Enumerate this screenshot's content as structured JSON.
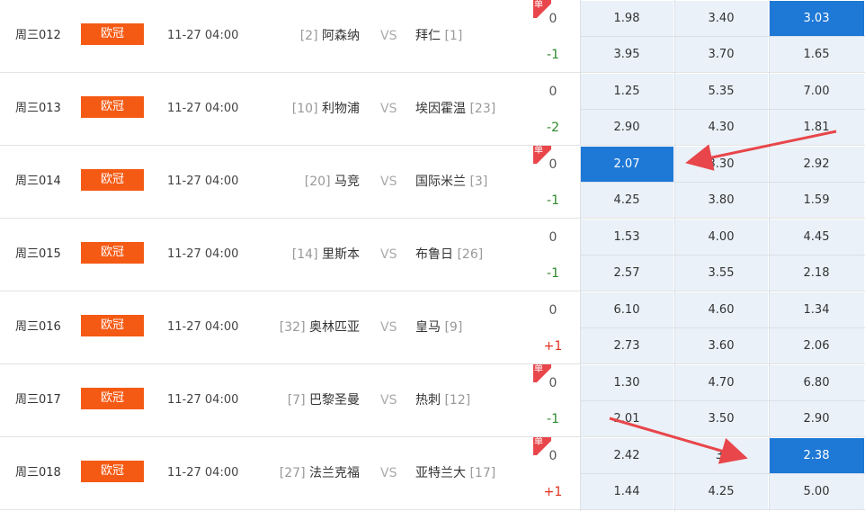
{
  "matches": [
    {
      "num": "周三012",
      "league": "欧冠",
      "time": "11-27 04:00",
      "home_rank": "[2]",
      "home": "阿森纳",
      "vs": "VS",
      "away": "拜仁",
      "away_rank": "[1]",
      "single": true,
      "hc1": "0",
      "hc2": "-1",
      "odds1": [
        "1.98",
        "3.40",
        "3.03"
      ],
      "odds2": [
        "3.95",
        "3.70",
        "1.65"
      ],
      "sel": [
        0,
        2
      ]
    },
    {
      "num": "周三013",
      "league": "欧冠",
      "time": "11-27 04:00",
      "home_rank": "[10]",
      "home": "利物浦",
      "vs": "VS",
      "away": "埃因霍温",
      "away_rank": "[23]",
      "single": false,
      "hc1": "0",
      "hc2": "-2",
      "odds1": [
        "1.25",
        "5.35",
        "7.00"
      ],
      "odds2": [
        "2.90",
        "4.30",
        "1.81"
      ],
      "sel": null
    },
    {
      "num": "周三014",
      "league": "欧冠",
      "time": "11-27 04:00",
      "home_rank": "[20]",
      "home": "马竞",
      "vs": "VS",
      "away": "国际米兰",
      "away_rank": "[3]",
      "single": true,
      "hc1": "0",
      "hc2": "-1",
      "odds1": [
        "2.07",
        "3.30",
        "2.92"
      ],
      "odds2": [
        "4.25",
        "3.80",
        "1.59"
      ],
      "sel": [
        0,
        0
      ]
    },
    {
      "num": "周三015",
      "league": "欧冠",
      "time": "11-27 04:00",
      "home_rank": "[14]",
      "home": "里斯本",
      "vs": "VS",
      "away": "布鲁日",
      "away_rank": "[26]",
      "single": false,
      "hc1": "0",
      "hc2": "-1",
      "odds1": [
        "1.53",
        "4.00",
        "4.45"
      ],
      "odds2": [
        "2.57",
        "3.55",
        "2.18"
      ],
      "sel": null
    },
    {
      "num": "周三016",
      "league": "欧冠",
      "time": "11-27 04:00",
      "home_rank": "[32]",
      "home": "奥林匹亚",
      "vs": "VS",
      "away": "皇马",
      "away_rank": "[9]",
      "single": false,
      "hc1": "0",
      "hc2": "+1",
      "odds1": [
        "6.10",
        "4.60",
        "1.34"
      ],
      "odds2": [
        "2.73",
        "3.60",
        "2.06"
      ],
      "sel": null
    },
    {
      "num": "周三017",
      "league": "欧冠",
      "time": "11-27 04:00",
      "home_rank": "[7]",
      "home": "巴黎圣曼",
      "vs": "VS",
      "away": "热刺",
      "away_rank": "[12]",
      "single": true,
      "hc1": "0",
      "hc2": "-1",
      "odds1": [
        "1.30",
        "4.70",
        "6.80"
      ],
      "odds2": [
        "2.01",
        "3.50",
        "2.90"
      ],
      "sel": null
    },
    {
      "num": "周三018",
      "league": "欧冠",
      "time": "11-27 04:00",
      "home_rank": "[27]",
      "home": "法兰克福",
      "vs": "VS",
      "away": "亚特兰大",
      "away_rank": "[17]",
      "single": true,
      "hc1": "0",
      "hc2": "+1",
      "odds1": [
        "2.42",
        "3.",
        "2.38"
      ],
      "odds2": [
        "1.44",
        "4.25",
        "5.00"
      ],
      "sel": [
        0,
        2
      ]
    }
  ],
  "single_badge": "单",
  "colors": {
    "league_bg": "#f55a14",
    "selected": "#1e78d6",
    "odds_bg": "#eaf1f8",
    "arrow": "#e8464a",
    "negative": "#2e8b2e",
    "positive": "#e0301e"
  }
}
